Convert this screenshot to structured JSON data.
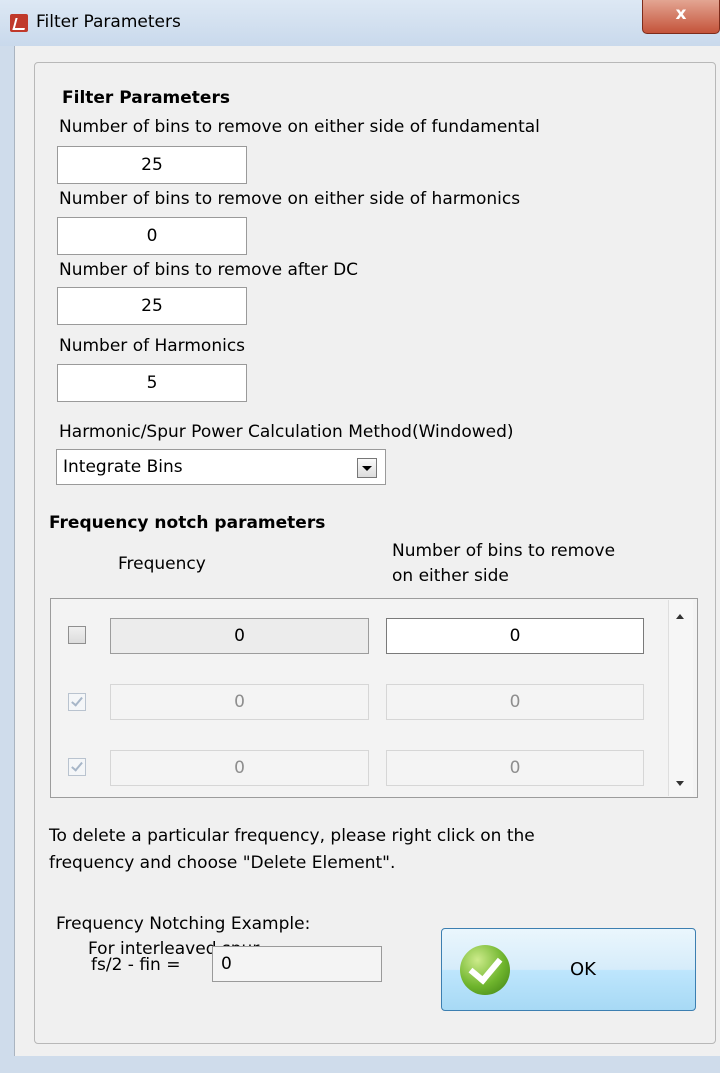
{
  "window": {
    "title": "Filter Parameters",
    "close_glyph": "x",
    "accent": "#3c7fb1"
  },
  "filter_params": {
    "heading": "Filter Parameters",
    "fundamental_label": "Number of bins to remove on either side of fundamental",
    "fundamental_value": "25",
    "harmonics_side_label": "Number of bins to remove on either side of harmonics",
    "harmonics_side_value": "0",
    "after_dc_label": "Number of bins to remove after DC",
    "after_dc_value": "25",
    "num_harmonics_label": "Number of Harmonics",
    "num_harmonics_value": "5",
    "method_label": "Harmonic/Spur Power Calculation Method(Windowed)",
    "method_value": "Integrate Bins"
  },
  "notch": {
    "heading": "Frequency notch parameters",
    "col_frequency": "Frequency",
    "col_bins_line1": "Number of bins to remove",
    "col_bins_line2": "on either side",
    "rows": [
      {
        "checked": false,
        "frequency": "0",
        "bins": "0"
      },
      {
        "checked": true,
        "frequency": "0",
        "bins": "0"
      },
      {
        "checked": true,
        "frequency": "0",
        "bins": "0"
      }
    ]
  },
  "help": {
    "line1": "To delete a particular frequency, please right click on the",
    "line2": "frequency and choose \"Delete Element\"."
  },
  "example": {
    "title": "Frequency Notching Example:",
    "subtitle": "For interleaved spur,",
    "formula_label": "fs/2 - fin =",
    "formula_value": "0"
  },
  "ok_button": {
    "label": "OK"
  }
}
